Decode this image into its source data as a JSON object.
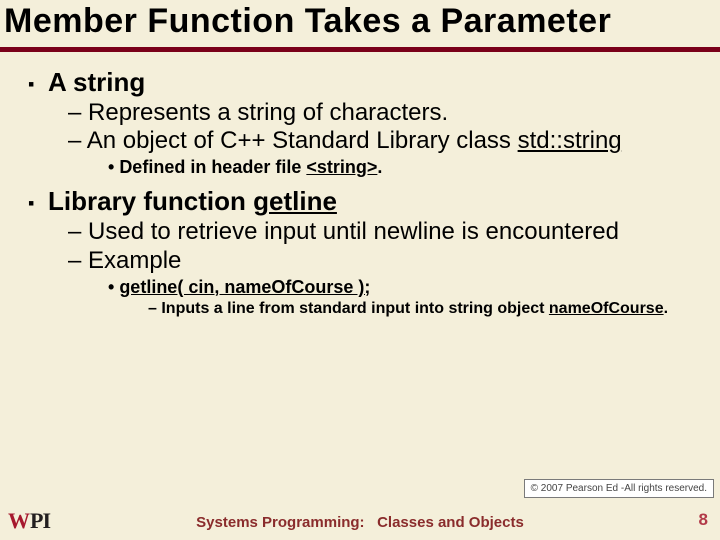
{
  "title": "Member Function Takes a Parameter",
  "section1": {
    "heading": "A string",
    "sub1": "Represents a string of characters.",
    "sub2_prefix": "An object of C++ Standard Library class ",
    "sub2_code": "std::string",
    "sub2_sub_prefix": "Defined in header file ",
    "sub2_sub_code": "<string>",
    "sub2_sub_suffix": "."
  },
  "section2": {
    "heading_prefix": "Library function ",
    "heading_code": "getline",
    "sub1": "Used to retrieve input until newline is encountered",
    "sub2": "Example",
    "sub2_code": "getline( cin, nameOfCourse );",
    "sub2_detail_prefix": "Inputs a line from standard input into string object ",
    "sub2_detail_code": "nameOfCourse",
    "sub2_detail_suffix": "."
  },
  "footer": {
    "copyright": "© 2007 Pearson Ed -All rights reserved.",
    "center_a": "Systems Programming:",
    "center_b": "Classes and Objects",
    "page": "8",
    "logo_w": "W",
    "logo_pi": "PI"
  }
}
